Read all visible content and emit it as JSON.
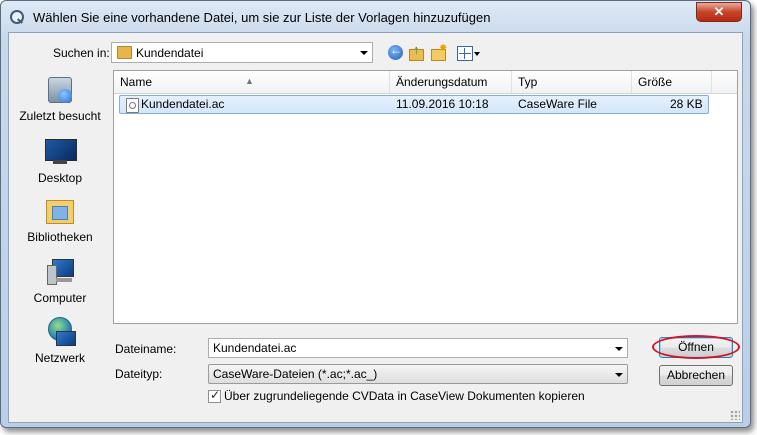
{
  "window": {
    "title": "Wählen Sie eine vorhandene Datei, um sie zur Liste der Vorlagen hinzuzufügen",
    "close_label": "✕"
  },
  "toolbar": {
    "look_in_label": "Suchen in:",
    "look_in_value": "Kundendatei",
    "icons": [
      "back-icon",
      "up-folder-icon",
      "new-folder-icon",
      "view-menu-icon"
    ]
  },
  "places": [
    {
      "label": "Zuletzt besucht",
      "icon": "recent-places-icon"
    },
    {
      "label": "Desktop",
      "icon": "desktop-icon"
    },
    {
      "label": "Bibliotheken",
      "icon": "libraries-icon"
    },
    {
      "label": "Computer",
      "icon": "computer-icon"
    },
    {
      "label": "Netzwerk",
      "icon": "network-icon"
    }
  ],
  "file_list": {
    "columns": [
      "Name",
      "Änderungsdatum",
      "Typ",
      "Größe"
    ],
    "rows": [
      {
        "name": "Kundendatei.ac",
        "date": "11.09.2016 10:18",
        "type": "CaseWare File",
        "size": "28 KB",
        "selected": true
      }
    ]
  },
  "form": {
    "filename_label": "Dateiname:",
    "filename_value": "Kundendatei.ac",
    "filetype_label": "Dateityp:",
    "filetype_value": "CaseWare-Dateien (*.ac;*.ac_)",
    "checkbox_label": "Über zugrundeliegende CVData in CaseView Dokumenten kopieren",
    "checkbox_checked": true
  },
  "buttons": {
    "open": "Öffnen",
    "cancel": "Abbrechen"
  },
  "colors": {
    "highlight_ring": "#d0142a",
    "selection": "#d3e6fa",
    "close_button": "#c7442c"
  }
}
